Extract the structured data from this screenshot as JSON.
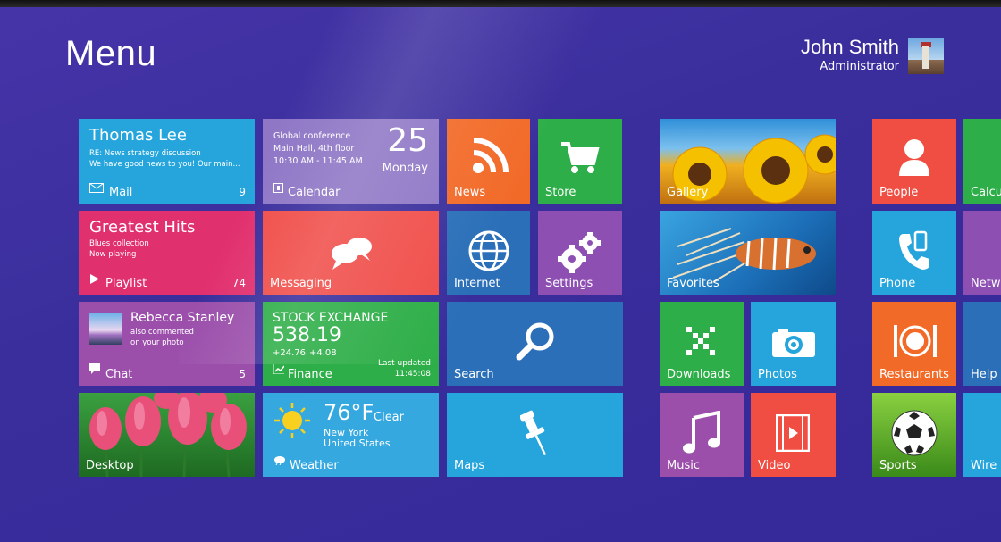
{
  "header": {
    "title": "Menu",
    "user_name": "John Smith",
    "user_role": "Administrator"
  },
  "colors": {
    "background": "#3a2f9a",
    "cyan": "#25a5dc",
    "magenta": "#d33b7a",
    "violet": "#8e4fb3",
    "red": "#f04e42",
    "orange": "#f26a28",
    "green": "#2eae48",
    "blue": "#2a6fb8"
  },
  "tiles": {
    "mail": {
      "sender": "Thomas Lee",
      "line1": "RE: News strategy discussion",
      "line2": "We have good news to you! Our main...",
      "label": "Mail",
      "count": "9",
      "icon": "envelope-icon"
    },
    "calendar": {
      "line1": "Global conference",
      "line2": "Main Hall, 4th floor",
      "line3": "10:30 AM - 11:45 AM",
      "day": "25",
      "weekday": "Monday",
      "label": "Calendar",
      "icon": "calendar-icon"
    },
    "news": {
      "label": "News",
      "icon": "rss-icon"
    },
    "store": {
      "label": "Store",
      "icon": "cart-icon"
    },
    "gallery": {
      "label": "Gallery"
    },
    "people": {
      "label": "People",
      "icon": "person-icon"
    },
    "calc": {
      "label": "Calcu"
    },
    "playlist": {
      "title": "Greatest Hits",
      "line1": "Blues collection",
      "line2": "Now playing",
      "label": "Playlist",
      "count": "74",
      "icon": "play-icon"
    },
    "messaging": {
      "label": "Messaging",
      "icon": "chat-bubbles-icon"
    },
    "internet": {
      "label": "Internet",
      "icon": "globe-icon"
    },
    "settings": {
      "label": "Settings",
      "icon": "gears-icon"
    },
    "favorites": {
      "label": "Favorites"
    },
    "phone": {
      "label": "Phone",
      "icon": "phone-icon"
    },
    "network": {
      "label": "Netw"
    },
    "chat": {
      "name": "Rebecca Stanley",
      "line1": "also commented",
      "line2": "on your photo",
      "label": "Chat",
      "count": "5",
      "icon": "chat-icon"
    },
    "finance": {
      "title": "STOCK EXCHANGE",
      "value": "538.19",
      "change1": "+24.76",
      "change2": "+4.08",
      "updated_label": "Last updated",
      "updated_time": "11:45:08",
      "label": "Finance",
      "icon": "chart-icon"
    },
    "search": {
      "label": "Search",
      "icon": "magnifier-icon"
    },
    "downloads": {
      "label": "Downloads",
      "icon": "downloads-icon"
    },
    "photos": {
      "label": "Photos",
      "icon": "camera-icon"
    },
    "restaurants": {
      "label": "Restaurants",
      "icon": "plate-icon"
    },
    "help": {
      "label": "Help"
    },
    "desktop": {
      "label": "Desktop"
    },
    "weather": {
      "temp": "76°F",
      "condition": "Clear",
      "city": "New York",
      "country": "United States",
      "label": "Weather",
      "icon": "sun-icon"
    },
    "maps": {
      "label": "Maps",
      "icon": "pushpin-icon"
    },
    "music": {
      "label": "Music",
      "icon": "music-note-icon"
    },
    "video": {
      "label": "Video",
      "icon": "film-icon"
    },
    "sports": {
      "label": "Sports",
      "icon": "soccer-ball-icon"
    },
    "wireless": {
      "label": "Wire"
    }
  }
}
